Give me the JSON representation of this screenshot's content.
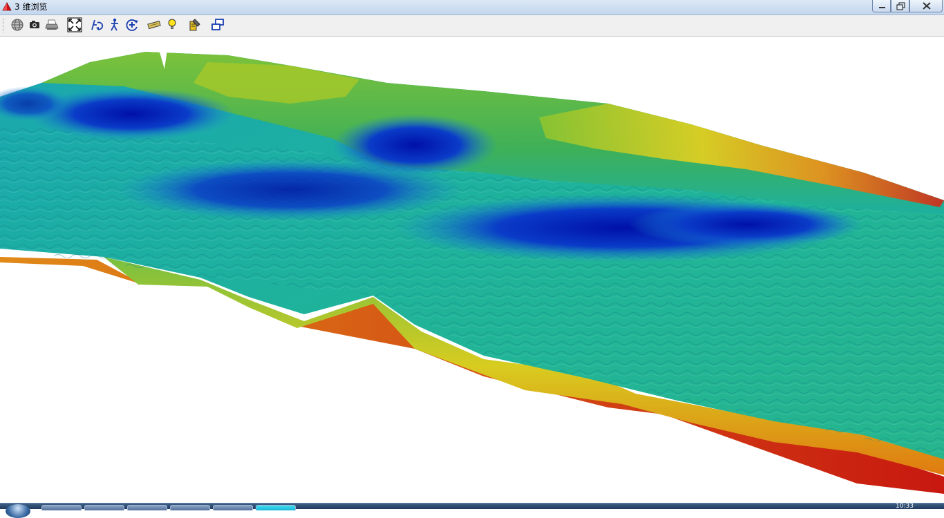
{
  "window": {
    "title": "3 维浏览",
    "app_icon": "red-cube-icon",
    "controls": [
      "minimize-icon",
      "restore-icon",
      "close-icon"
    ]
  },
  "toolbar": {
    "buttons": [
      {
        "id": "globe",
        "icon": "globe-icon"
      },
      {
        "id": "snapshot",
        "icon": "camera-icon"
      },
      {
        "id": "print",
        "icon": "printer-icon"
      },
      {
        "id": "full-extent",
        "icon": "expand-arrows-icon"
      },
      {
        "id": "rotate",
        "icon": "rotate-icon"
      },
      {
        "id": "pan-person",
        "icon": "walk-icon"
      },
      {
        "id": "zoom-in",
        "icon": "zoom-in-icon"
      },
      {
        "id": "layer",
        "icon": "tag-icon"
      },
      {
        "id": "light",
        "icon": "lightbulb-icon"
      },
      {
        "id": "settings",
        "icon": "settings-tool-icon"
      },
      {
        "id": "windows",
        "icon": "window-switch-icon"
      }
    ]
  },
  "scene": {
    "type": "3d-terrain",
    "colormap": [
      "#0018b0",
      "#0a5fd0",
      "#18a8c8",
      "#20b8a0",
      "#36b050",
      "#8cc430",
      "#e0d020",
      "#f08010",
      "#d02010"
    ]
  },
  "taskbar": {
    "clock": "10:33"
  }
}
